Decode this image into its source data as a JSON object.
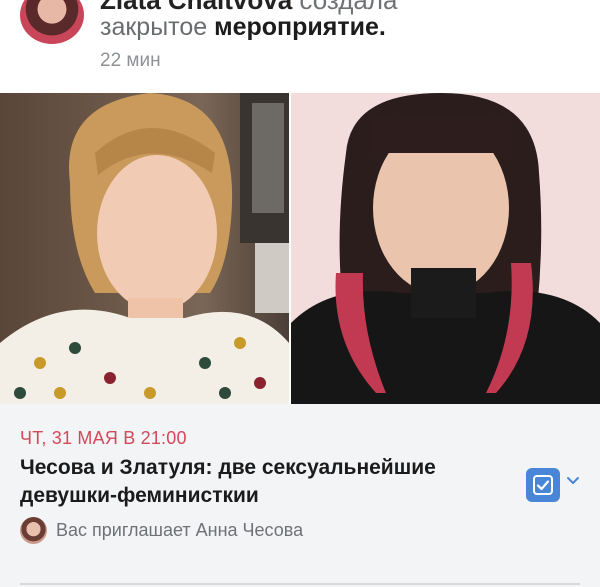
{
  "post": {
    "author": "Zlata Chaitvova",
    "action_prefix": "создала",
    "action_text": "закрытое",
    "action_bold": "мероприятие.",
    "time": "22 мин"
  },
  "event": {
    "date": "ЧТ, 31 МАЯ В 21:00",
    "title": "Чесова и Златуля: две сексуальнейшие девушки-феминисткии",
    "invite_text": "Вас приглашает Анна Чесова"
  },
  "icons": {
    "status": "checkbox-checked-icon",
    "dropdown": "chevron-down-icon"
  },
  "colors": {
    "accent": "#4a86d8",
    "date": "#d14a5a",
    "card_bg": "#f3f4f6"
  }
}
